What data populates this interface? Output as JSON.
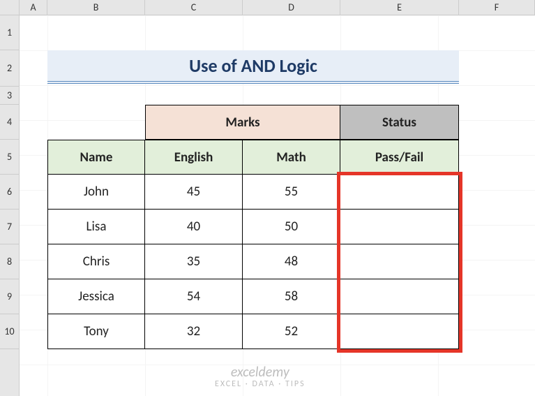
{
  "columns": {
    "A": "A",
    "B": "B",
    "C": "C",
    "D": "D",
    "E": "E",
    "F": "F"
  },
  "rows": {
    "1": "1",
    "2": "2",
    "3": "3",
    "4": "4",
    "5": "5",
    "6": "6",
    "7": "7",
    "8": "8",
    "9": "9",
    "10": "10"
  },
  "title": "Use of AND Logic",
  "headers": {
    "marks": "Marks",
    "status": "Status",
    "name": "Name",
    "english": "English",
    "math": "Math",
    "passfail": "Pass/Fail"
  },
  "data": [
    {
      "name": "John",
      "english": 45,
      "math": 55,
      "status": ""
    },
    {
      "name": "Lisa",
      "english": 40,
      "math": 50,
      "status": ""
    },
    {
      "name": "Chris",
      "english": 35,
      "math": 48,
      "status": ""
    },
    {
      "name": "Jessica",
      "english": 54,
      "math": 58,
      "status": ""
    },
    {
      "name": "Tony",
      "english": 32,
      "math": 52,
      "status": ""
    }
  ],
  "watermark": {
    "brand": "exceldemy",
    "tagline": "EXCEL · DATA · TIPS"
  },
  "chart_data": {
    "type": "table",
    "title": "Use of AND Logic",
    "columns": [
      "Name",
      "English",
      "Math",
      "Pass/Fail"
    ],
    "rows": [
      [
        "John",
        45,
        55,
        null
      ],
      [
        "Lisa",
        40,
        50,
        null
      ],
      [
        "Chris",
        35,
        48,
        null
      ],
      [
        "Jessica",
        54,
        58,
        null
      ],
      [
        "Tony",
        32,
        52,
        null
      ]
    ]
  }
}
